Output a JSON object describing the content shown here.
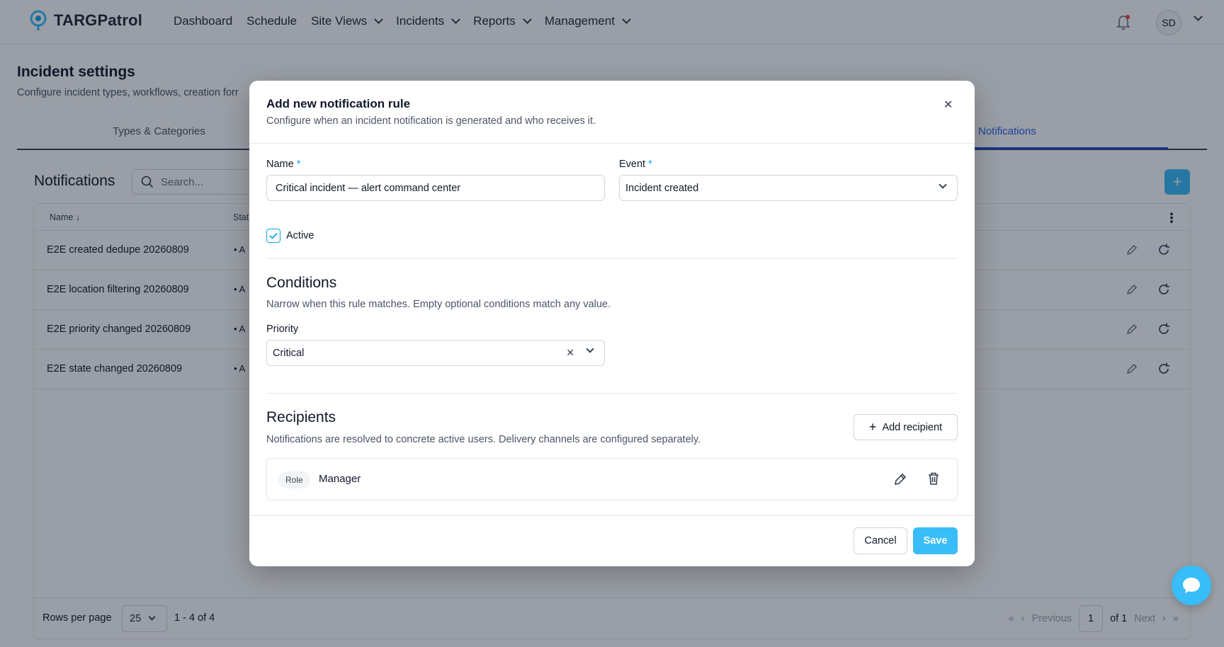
{
  "app": {
    "brand": "TARGPatrol"
  },
  "nav": {
    "items": [
      {
        "label": "Dashboard",
        "has_menu": false
      },
      {
        "label": "Schedule",
        "has_menu": false
      },
      {
        "label": "Site Views",
        "has_menu": true
      },
      {
        "label": "Incidents",
        "has_menu": true
      },
      {
        "label": "Reports",
        "has_menu": true
      },
      {
        "label": "Management",
        "has_menu": true
      }
    ],
    "user_initials": "SD"
  },
  "page": {
    "title": "Incident settings",
    "subtitle": "Configure incident types, workflows, creation forr",
    "tabs": [
      {
        "label": "Types & Categories",
        "active": false
      },
      {
        "label": "Notifications",
        "active": true
      }
    ]
  },
  "notifications": {
    "title": "Notifications",
    "search_placeholder": "Search...",
    "columns": {
      "name": "Name",
      "status": "Stat"
    },
    "rows": [
      {
        "name": "E2E created dedupe 20260809",
        "status": "A"
      },
      {
        "name": "E2E location filtering 20260809",
        "status": "A"
      },
      {
        "name": "E2E priority changed 20260809",
        "status": "A"
      },
      {
        "name": "E2E state changed 20260809",
        "status": "A"
      }
    ],
    "footer": {
      "rows_per_page_label": "Rows per page",
      "rows_per_page": "25",
      "range": "1 - 4 of 4",
      "previous": "Previous",
      "next": "Next",
      "page": "1",
      "of_total": "of 1"
    }
  },
  "modal": {
    "title": "Add new notification rule",
    "subtitle": "Configure when an incident notification is generated and who receives it.",
    "name_label": "Name",
    "name_value": "Critical incident — alert command center",
    "event_label": "Event",
    "event_value": "Incident created",
    "required_mark": "*",
    "active_label": "Active",
    "active_checked": true,
    "conditions": {
      "title": "Conditions",
      "subtitle": "Narrow when this rule matches. Empty optional conditions match any value.",
      "priority_label": "Priority",
      "priority_value": "Critical"
    },
    "recipients": {
      "title": "Recipients",
      "subtitle": "Notifications are resolved to concrete active users. Delivery channels are configured separately.",
      "add_label": "Add recipient",
      "items": [
        {
          "type": "Role",
          "name": "Manager"
        }
      ]
    },
    "cancel_label": "Cancel",
    "save_label": "Save"
  },
  "colors": {
    "accent": "#38bdf8",
    "link": "#2563eb",
    "overlay": "rgba(15,23,42,0.42)"
  },
  "icons": [
    "logo-icon",
    "chevron-down-icon",
    "bell-icon",
    "search-icon",
    "plus-icon",
    "sort-down-icon",
    "kebab-icon",
    "pencil-icon",
    "refresh-icon",
    "close-icon",
    "check-icon",
    "trash-icon",
    "chat-icon",
    "first-page-icon",
    "prev-page-icon",
    "next-page-icon",
    "last-page-icon"
  ]
}
